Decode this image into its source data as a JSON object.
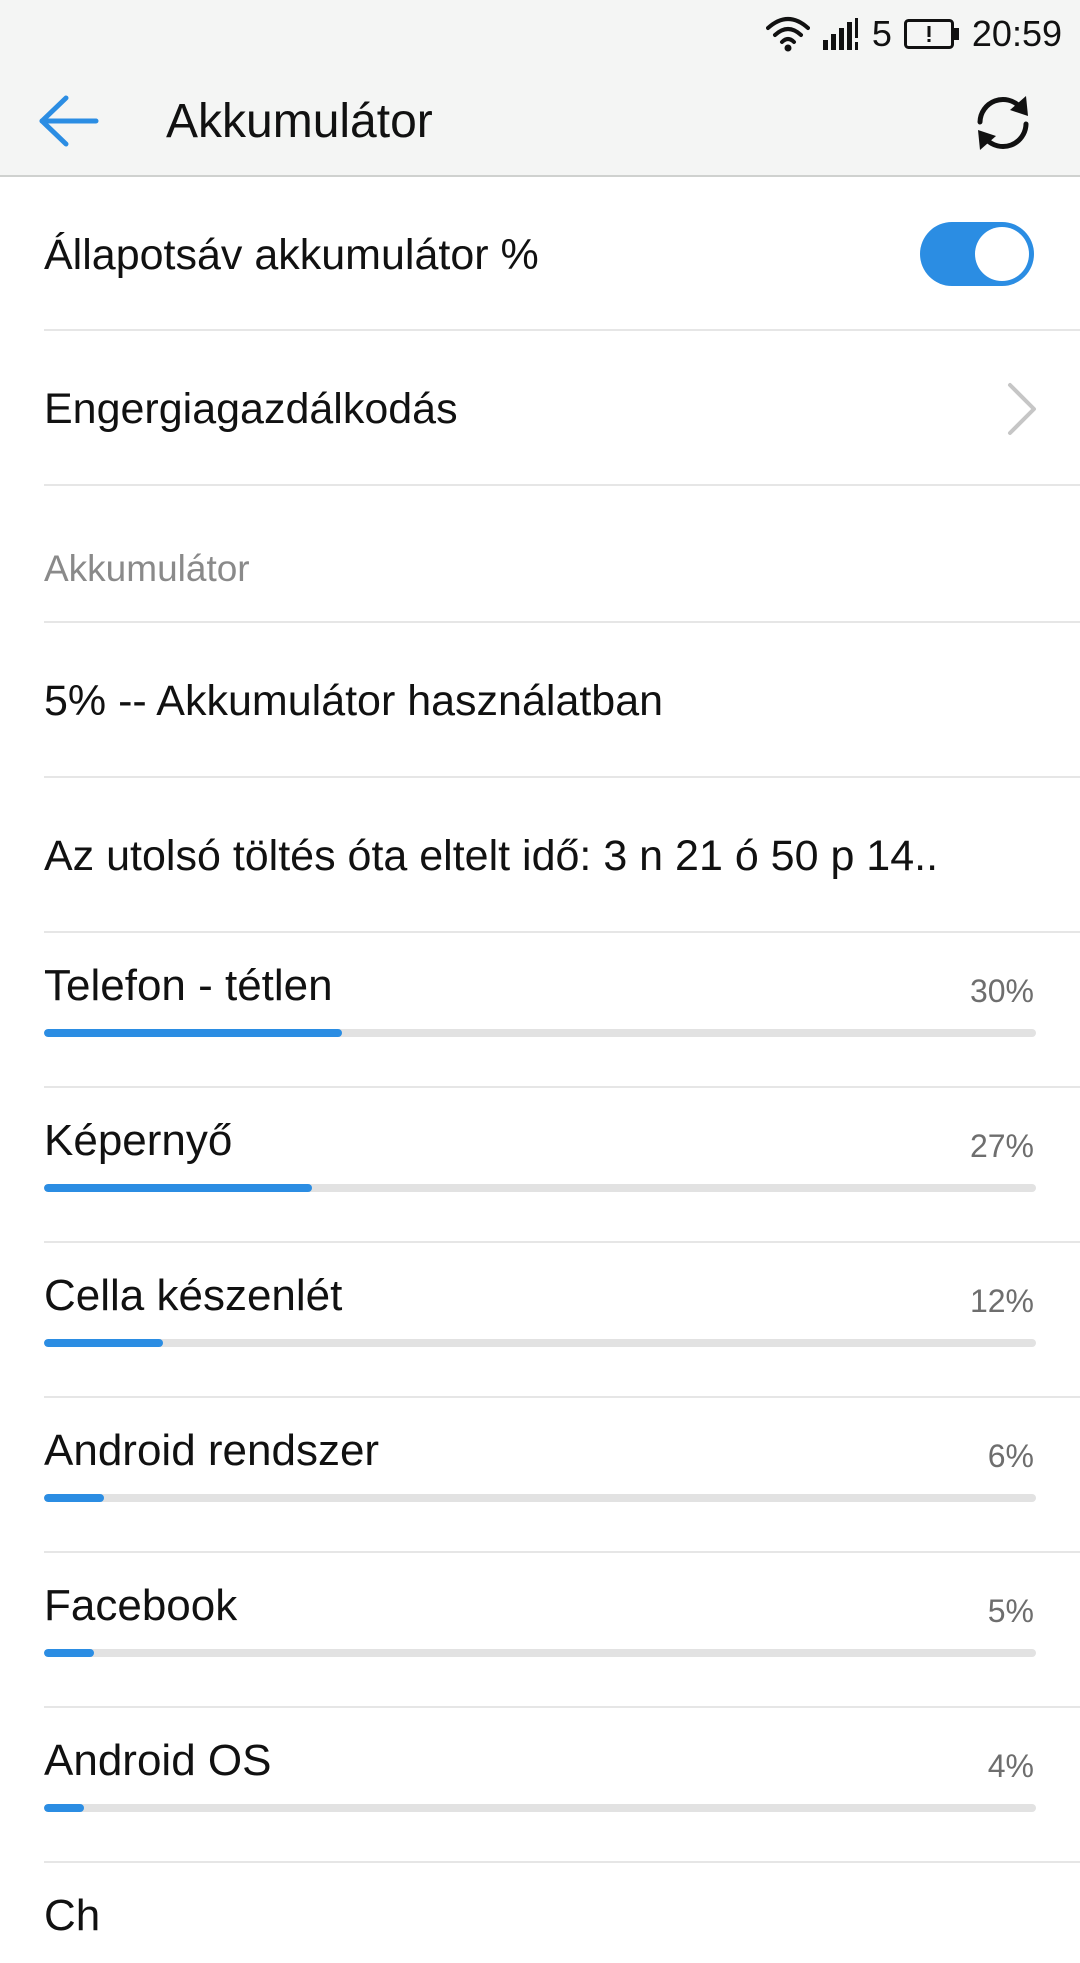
{
  "status_bar": {
    "signal_label": "5",
    "time": "20:59",
    "icons": [
      "wifi-icon",
      "signal-icon",
      "battery-alert-icon"
    ]
  },
  "header": {
    "back_icon": "arrow-left-icon",
    "title": "Akkumulátor",
    "refresh_icon": "refresh-icon"
  },
  "settings": {
    "statusbar_percent": {
      "label": "Állapotsáv akkumulátor %",
      "enabled": true
    },
    "power_management": {
      "label": "Engergiagazdálkodás"
    }
  },
  "battery_section": {
    "header": "Akkumulátor",
    "status": "5% -- Akkumulátor használatban",
    "since_charge": "Az utolsó töltés óta eltelt idő: 3 n 21 ó 50 p 14.."
  },
  "usage": [
    {
      "name": "Telefon - tétlen",
      "percent_label": "30%",
      "percent": 30
    },
    {
      "name": "Képernyő",
      "percent_label": "27%",
      "percent": 27
    },
    {
      "name": "Cella készenlét",
      "percent_label": "12%",
      "percent": 12
    },
    {
      "name": "Android rendszer",
      "percent_label": "6%",
      "percent": 6
    },
    {
      "name": "Facebook",
      "percent_label": "5%",
      "percent": 5
    },
    {
      "name": "Android OS",
      "percent_label": "4%",
      "percent": 4
    }
  ],
  "partial_item": {
    "name": "Ch"
  },
  "colors": {
    "accent": "#2b8de3",
    "bar_background": "#f4f5f4",
    "track": "#e2e2e2",
    "secondary_text": "#6e6e6e"
  }
}
